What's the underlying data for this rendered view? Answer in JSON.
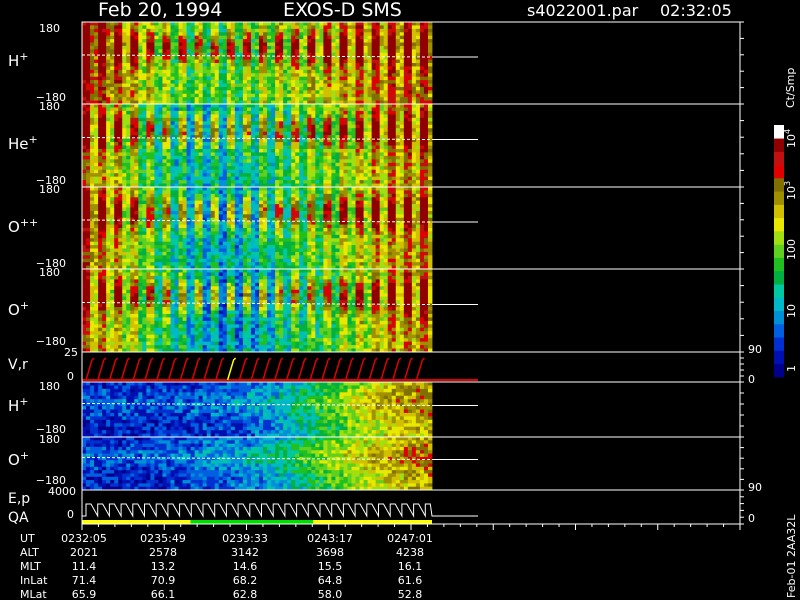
{
  "header": {
    "date": "Feb 20, 1994",
    "instrument": "EXOS-D SMS",
    "file": "s4022001.par",
    "time": "02:32:05"
  },
  "colorbar": {
    "unit_label": "Ct/Smp",
    "tick_labels": [
      "1",
      "10",
      "100",
      "10",
      "10"
    ],
    "tick_exponents": [
      "",
      "",
      "",
      "3",
      "4"
    ],
    "colors": [
      "#00008b",
      "#0010b0",
      "#0030d0",
      "#0060e0",
      "#0090d8",
      "#00b8c8",
      "#00c8a0",
      "#00b040",
      "#20c020",
      "#60d020",
      "#a0e010",
      "#e8e800",
      "#d0c000",
      "#a09000",
      "#807000",
      "#e00000",
      "#c01010",
      "#900000",
      "#ffffff"
    ]
  },
  "footer": {
    "vertical_text": "Feb-01 2AA32L",
    "row_labels": [
      "UT",
      "ALT",
      "MLT",
      "InLat",
      "MLat"
    ],
    "columns": [
      [
        "0232:05",
        "2021",
        "11.4",
        "71.4",
        "65.9"
      ],
      [
        "0235:49",
        "2578",
        "13.2",
        "70.9",
        "66.1"
      ],
      [
        "0239:33",
        "3142",
        "14.6",
        "68.2",
        "62.8"
      ],
      [
        "0243:17",
        "3698",
        "15.5",
        "64.8",
        "58.0"
      ],
      [
        "0247:01",
        "4238",
        "16.1",
        "61.6",
        "52.8"
      ]
    ]
  },
  "chart_data": [
    {
      "type": "heatmap",
      "species": "H",
      "charge": "+",
      "y_top": "180",
      "y_bottom": "−180",
      "ylim": [
        -180,
        180
      ],
      "ions": [
        0.9,
        0.75,
        0.55,
        0.45,
        0.45,
        0.5,
        0.55,
        0.65,
        0.7,
        0.75,
        0.8
      ]
    },
    {
      "type": "heatmap",
      "species": "He",
      "charge": "+",
      "y_top": "180",
      "y_bottom": "−180",
      "ylim": [
        -180,
        180
      ],
      "ions": [
        0.75,
        0.6,
        0.4,
        0.3,
        0.3,
        0.35,
        0.4,
        0.5,
        0.6,
        0.7,
        0.75
      ]
    },
    {
      "type": "heatmap",
      "species": "O",
      "charge": "++",
      "y_top": "180",
      "y_bottom": "−180",
      "ylim": [
        -180,
        180
      ],
      "ions": [
        0.8,
        0.65,
        0.45,
        0.3,
        0.25,
        0.3,
        0.4,
        0.5,
        0.6,
        0.7,
        0.75
      ]
    },
    {
      "type": "heatmap",
      "species": "O",
      "charge": "+",
      "y_top": "180",
      "y_bottom": "−180",
      "ylim": [
        -180,
        180
      ],
      "ions": [
        0.75,
        0.6,
        0.45,
        0.3,
        0.2,
        0.25,
        0.35,
        0.45,
        0.55,
        0.7,
        0.75
      ]
    },
    {
      "type": "line",
      "label": "V,r",
      "y_top": "25",
      "y_bottom": "0",
      "right_top": "90",
      "right_bottom": "0",
      "ylim": [
        0,
        25
      ]
    },
    {
      "type": "heatmap",
      "species": "H",
      "charge": "+",
      "y_top": "180",
      "y_bottom": "−180",
      "ylim": [
        -180,
        180
      ],
      "ions": [
        0.1,
        0.1,
        0.1,
        0.12,
        0.15,
        0.2,
        0.3,
        0.45,
        0.6,
        0.7,
        0.75
      ]
    },
    {
      "type": "heatmap",
      "species": "O",
      "charge": "+",
      "y_top": "180",
      "y_bottom": "−180",
      "ylim": [
        -180,
        180
      ],
      "ions": [
        0.1,
        0.1,
        0.12,
        0.15,
        0.2,
        0.25,
        0.35,
        0.5,
        0.62,
        0.72,
        0.78
      ]
    },
    {
      "type": "line",
      "label1": "E,p",
      "label2": "QA",
      "y_top": "4000",
      "y_bottom": "0",
      "right_top": "90",
      "right_bottom": "0",
      "ylim": [
        0,
        4000
      ]
    }
  ]
}
